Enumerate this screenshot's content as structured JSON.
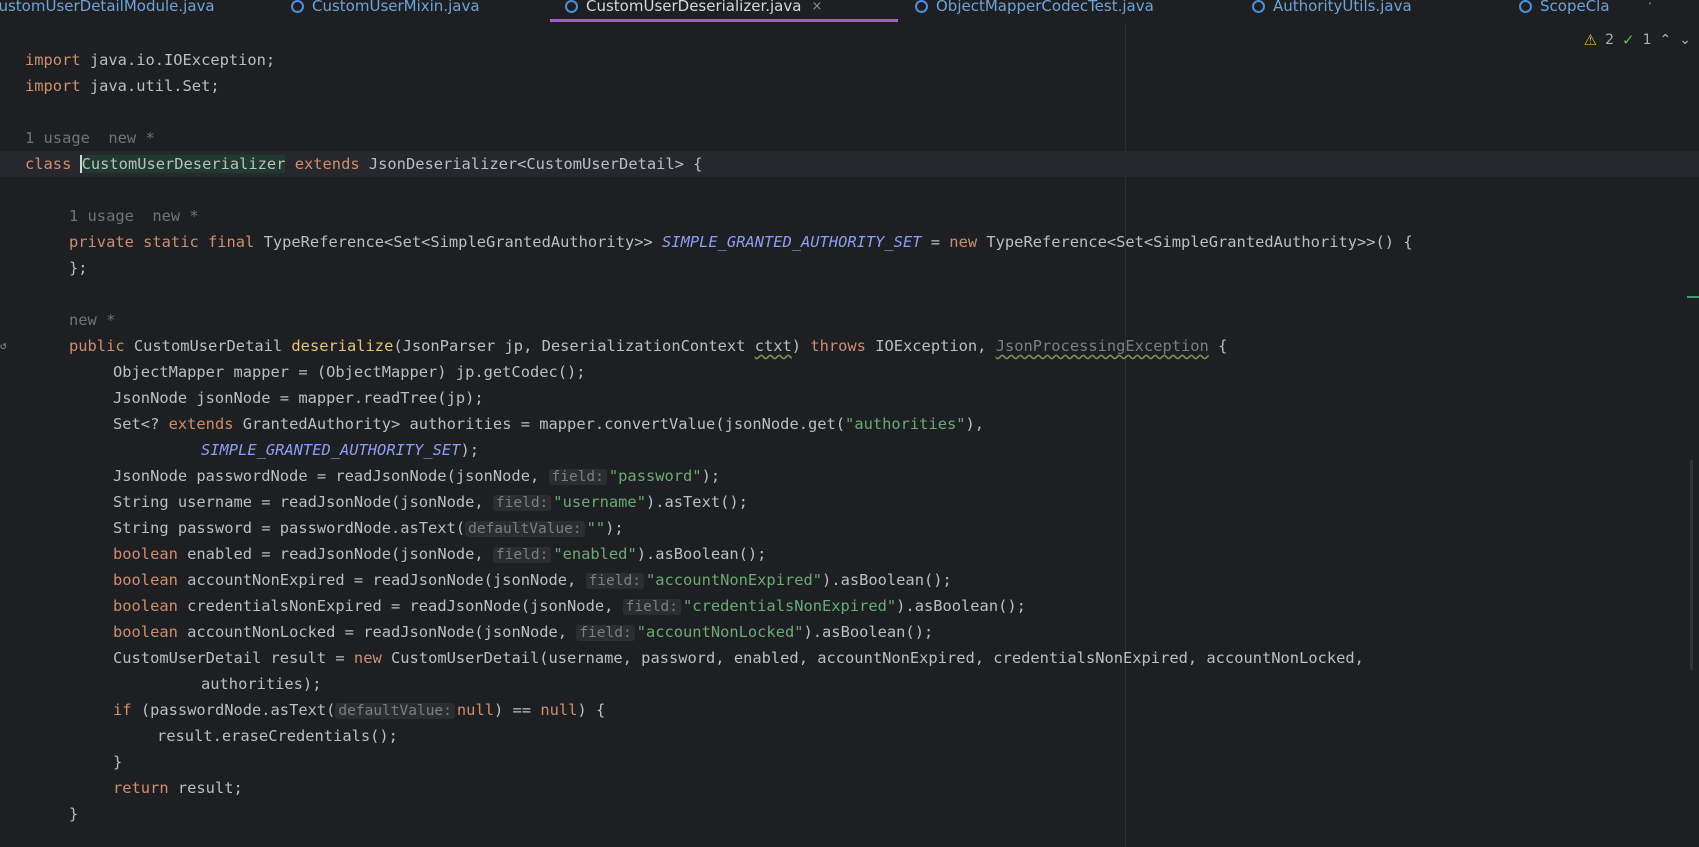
{
  "tabs": [
    {
      "label": "CustomUserDetailModule.java",
      "active": false
    },
    {
      "label": "CustomUserMixin.java",
      "active": false
    },
    {
      "label": "CustomUserDeserializer.java",
      "active": true
    },
    {
      "label": "ObjectMapperCodecTest.java",
      "active": false
    },
    {
      "label": "AuthorityUtils.java",
      "active": false
    },
    {
      "label": "ScopeCla",
      "active": false
    }
  ],
  "tab_close": "×",
  "tab_more": "⋮",
  "inspection": {
    "warnings": "2",
    "ok": "1"
  },
  "code": {
    "import1_kw": "import",
    "import1": " java.io.IOException;",
    "import2_kw": "import",
    "import2": " java.util.Set;",
    "meta_class": "1 usage  new *",
    "class_kw": "class ",
    "class_name": "CustomUserDeserializer",
    "extends_kw": " extends ",
    "class_rest": "JsonDeserializer<CustomUserDetail> {",
    "meta_field": "1 usage  new *",
    "field_mods": "private static final",
    "field_type": " TypeReference<Set<SimpleGrantedAuthority>> ",
    "field_name": "SIMPLE_GRANTED_AUTHORITY_SET",
    "field_eq": " = ",
    "new_kw": "new",
    "field_rest": " TypeReference<Set<SimpleGrantedAuthority>>() {",
    "field_close": "};",
    "meta_method": "new *",
    "method_kw": "public",
    "method_type": " CustomUserDetail ",
    "method_name": "deserialize",
    "method_params_a": "(JsonParser jp, DeserializationContext ",
    "method_ctxt": "ctxt",
    "method_params_b": ") ",
    "throws_kw": "throws",
    "method_exc1": " IOException, ",
    "method_exc2": "JsonProcessingException",
    "method_open": " {",
    "l_mapper": "ObjectMapper mapper = (ObjectMapper) jp.getCodec();",
    "l_jsonnode": "JsonNode jsonNode = mapper.readTree(jp);",
    "l_set_a": "Set<? ",
    "l_set_ext": "extends",
    "l_set_b": " GrantedAuthority> authorities = mapper.convertValue(jsonNode.get(",
    "l_set_str": "\"authorities\"",
    "l_set_c": "),",
    "l_set_const": "SIMPLE_GRANTED_AUTHORITY_SET",
    "l_set_end": ");",
    "l_pwnode_a": "JsonNode passwordNode = readJsonNode(jsonNode, ",
    "hint_field": "field:",
    "l_pwnode_str": "\"password\"",
    "l_pwnode_end": ");",
    "l_user_a": "String username = readJsonNode(jsonNode, ",
    "l_user_str": "\"username\"",
    "l_user_end": ").asText();",
    "l_pw_a": "String password = passwordNode.asText(",
    "hint_default": "defaultValue:",
    "l_pw_str": "\"\"",
    "l_pw_end": ");",
    "bool_kw": "boolean",
    "l_en_a": " enabled = readJsonNode(jsonNode, ",
    "l_en_str": "\"enabled\"",
    "bool_end": ").asBoolean();",
    "l_ane_a": " accountNonExpired = readJsonNode(jsonNode, ",
    "l_ane_str": "\"accountNonExpired\"",
    "l_cne_a": " credentialsNonExpired = readJsonNode(jsonNode, ",
    "l_cne_str": "\"credentialsNonExpired\"",
    "l_anl_a": " accountNonLocked = readJsonNode(jsonNode, ",
    "l_anl_str": "\"accountNonLocked\"",
    "l_res_a": "CustomUserDetail result = ",
    "l_res_b": " CustomUserDetail(username, password, enabled, accountNonExpired, credentialsNonExpired, accountNonLocked,",
    "l_res_c": "authorities);",
    "if_kw": "if",
    "l_if_a": " (passwordNode.asText(",
    "null_kw": "null",
    "l_if_b": ") == ",
    "l_if_c": ") {",
    "l_erase": "result.eraseCredentials();",
    "close_brace": "}",
    "return_kw": "return",
    "l_return": " result;"
  }
}
